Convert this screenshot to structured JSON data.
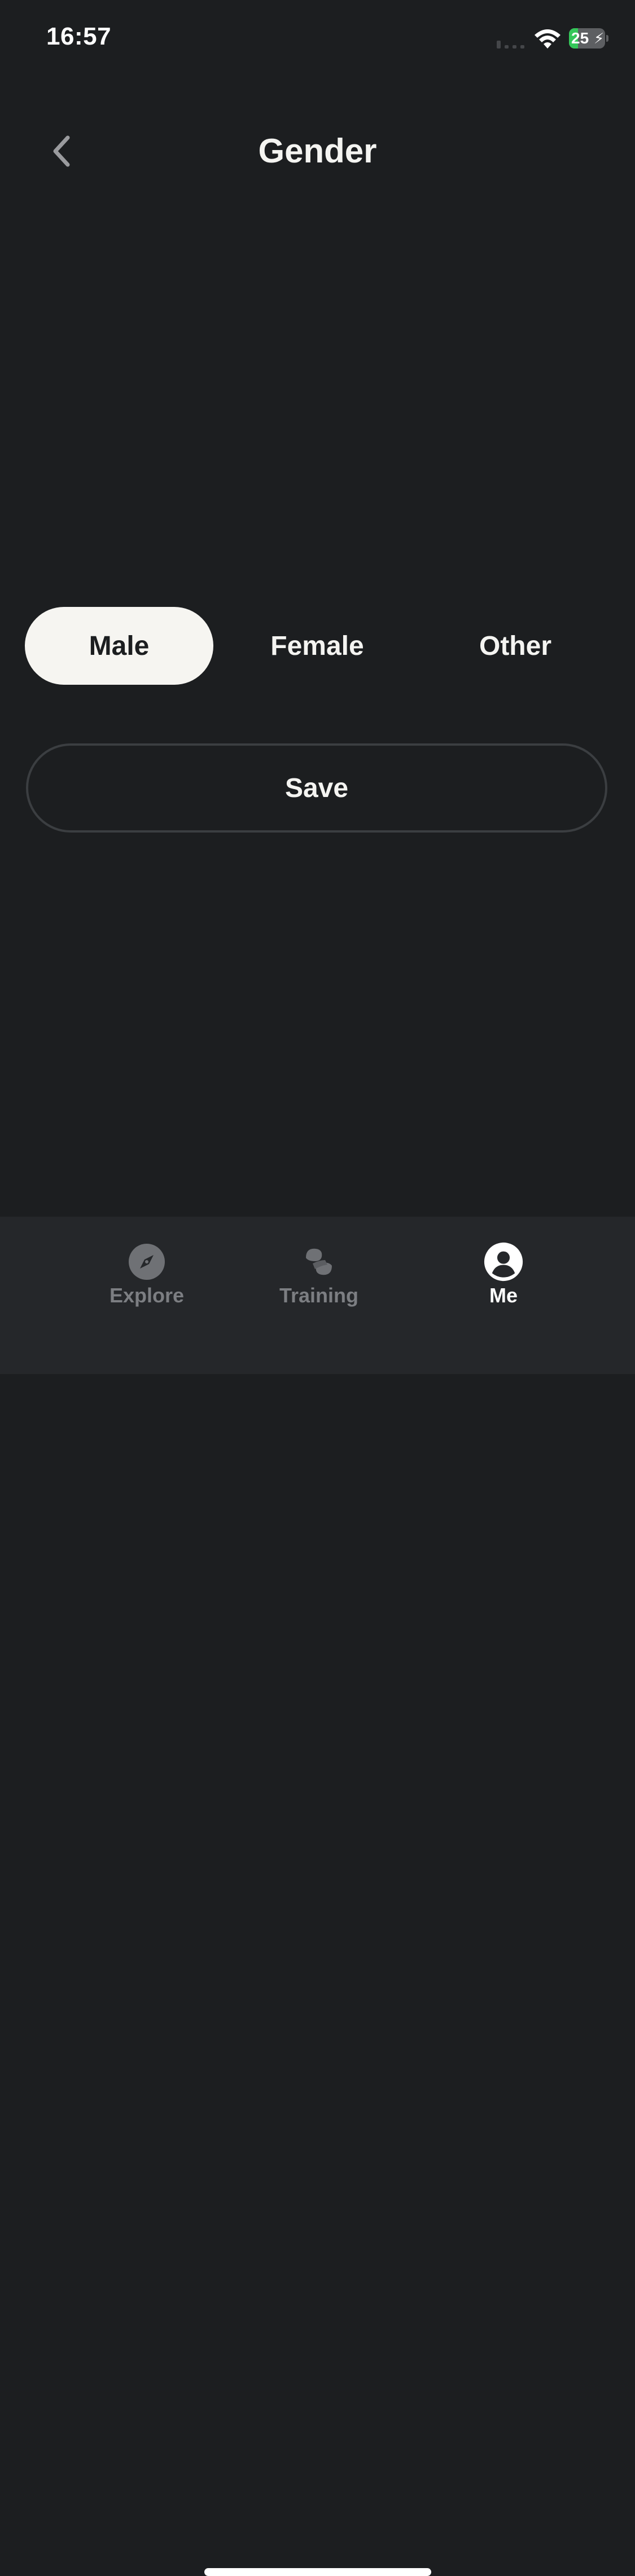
{
  "status_bar": {
    "time": "16:57",
    "battery_percent": "25",
    "battery_level": 0.25,
    "battery_charging": true,
    "icons": [
      "cellular-signal-icon",
      "wifi-icon",
      "battery-charging-icon"
    ]
  },
  "header": {
    "title": "Gender",
    "back_icon": "chevron-left-icon"
  },
  "gender": {
    "options": [
      {
        "label": "Male",
        "selected": true
      },
      {
        "label": "Female",
        "selected": false
      },
      {
        "label": "Other",
        "selected": false
      }
    ]
  },
  "actions": {
    "save_label": "Save"
  },
  "tab_bar": {
    "tabs": [
      {
        "label": "Explore",
        "icon": "compass-icon",
        "active": false
      },
      {
        "label": "Training",
        "icon": "training-icon",
        "active": false
      },
      {
        "label": "Me",
        "icon": "profile-icon",
        "active": true
      }
    ]
  },
  "colors": {
    "background": "#1c1e20",
    "tab_bar_background": "#25272a",
    "selected_pill": "#f6f5f1",
    "text_primary": "#f4f4f1",
    "text_inactive": "#7c7e82",
    "outline": "#3b3e41",
    "battery_fill": "#34c759"
  }
}
